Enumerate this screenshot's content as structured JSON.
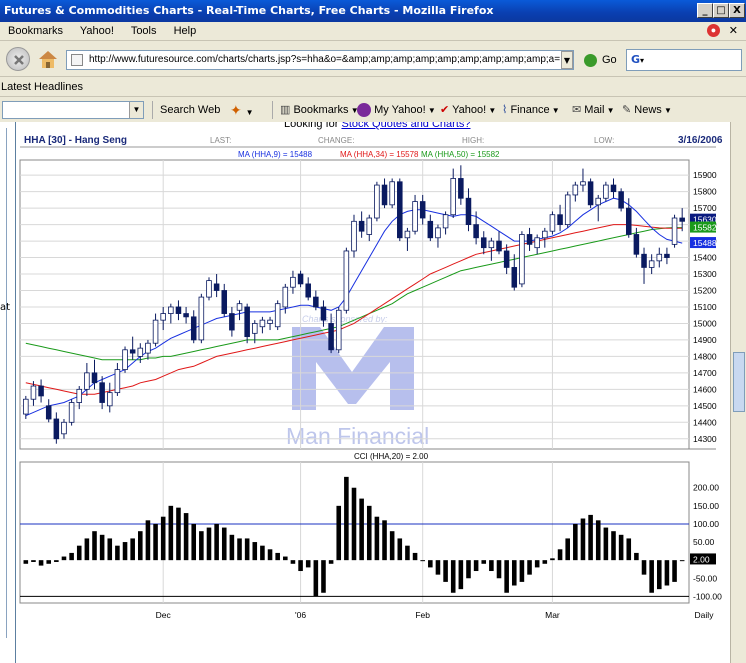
{
  "window": {
    "title": "Futures & Commodities Charts - Real-Time Charts, Free Charts - Mozilla Firefox",
    "minimize": "_",
    "maximize": "□",
    "close": "X"
  },
  "menu": {
    "items": [
      "Bookmarks",
      "Yahoo!",
      "Tools",
      "Help"
    ]
  },
  "nav": {
    "url": "http://www.futuresource.com/charts/charts.jsp?s=hha&o=&amp;amp;amp;amp;amp;amp;amp;amp;amp;a=",
    "go_label": "Go",
    "search_value": "G"
  },
  "headlines": {
    "label": "Latest Headlines"
  },
  "toolbar": {
    "search_web": "Search Web",
    "bookmarks": "Bookmarks",
    "my_yahoo": "My Yahoo!",
    "yahoo": "Yahoo!",
    "finance": "Finance",
    "mail": "Mail",
    "news": "News"
  },
  "page": {
    "looking_prefix": "Looking for ",
    "looking_link": "Stock Quotes and Charts?",
    "left_fragment": "at"
  },
  "chart_header": {
    "symbol": "HHA [30] - Hang Seng",
    "last_label": "LAST:",
    "change_label": "CHANGE:",
    "high_label": "HIGH:",
    "low_label": "LOW:",
    "date": "3/16/2006",
    "ma9": "MA (HHA,9) = 15488",
    "ma34": "MA (HHA,34) = 15578",
    "ma50": "MA (HHA,50) = 15582",
    "cci_title": "CCI (HHA,20) = 2.00",
    "watermark_sponsor": "Charts sponsored by:",
    "watermark_name": "Man Financial"
  },
  "chart_data": [
    {
      "type": "candlestick",
      "title": "HHA [30] - Hang Seng",
      "ylim": [
        14250,
        15980
      ],
      "y_ticks": [
        14300,
        14400,
        14500,
        14600,
        14700,
        14800,
        14900,
        15000,
        15100,
        15200,
        15300,
        15400,
        15500,
        15600,
        15700,
        15800,
        15900
      ],
      "x_ticks": [
        "Dec",
        "'06",
        "Feb",
        "Mar",
        "Daily"
      ],
      "price_tags": [
        {
          "label": "15630",
          "color": "#0a1a80"
        },
        {
          "label": "15582",
          "color": "#1a9a1a"
        },
        {
          "label": "15488",
          "color": "#1830e0"
        }
      ],
      "ohlc": [
        [
          14450,
          14560,
          14420,
          14540
        ],
        [
          14540,
          14650,
          14500,
          14620
        ],
        [
          14620,
          14660,
          14520,
          14560
        ],
        [
          14500,
          14540,
          14400,
          14420
        ],
        [
          14420,
          14460,
          14270,
          14300
        ],
        [
          14330,
          14420,
          14300,
          14400
        ],
        [
          14400,
          14540,
          14380,
          14520
        ],
        [
          14520,
          14620,
          14480,
          14600
        ],
        [
          14600,
          14760,
          14560,
          14700
        ],
        [
          14700,
          14780,
          14600,
          14640
        ],
        [
          14640,
          14680,
          14480,
          14520
        ],
        [
          14500,
          14640,
          14460,
          14580
        ],
        [
          14580,
          14760,
          14560,
          14720
        ],
        [
          14720,
          14860,
          14700,
          14840
        ],
        [
          14840,
          14920,
          14780,
          14820
        ],
        [
          14800,
          14880,
          14760,
          14850
        ],
        [
          14820,
          14900,
          14780,
          14880
        ],
        [
          14880,
          15060,
          14860,
          15020
        ],
        [
          15020,
          15100,
          14960,
          15060
        ],
        [
          15060,
          15120,
          15000,
          15100
        ],
        [
          15100,
          15140,
          15020,
          15060
        ],
        [
          15060,
          15100,
          15000,
          15040
        ],
        [
          15040,
          15080,
          14880,
          14900
        ],
        [
          14900,
          15180,
          14880,
          15160
        ],
        [
          15160,
          15280,
          15140,
          15260
        ],
        [
          15240,
          15300,
          15160,
          15200
        ],
        [
          15200,
          15240,
          15040,
          15060
        ],
        [
          15060,
          15100,
          14920,
          14960
        ],
        [
          15080,
          15140,
          15020,
          15120
        ],
        [
          15100,
          15120,
          14880,
          14920
        ],
        [
          14940,
          15020,
          14880,
          15000
        ],
        [
          14980,
          15040,
          14940,
          15020
        ],
        [
          15000,
          15040,
          14960,
          15020
        ],
        [
          14980,
          15140,
          14960,
          15120
        ],
        [
          15100,
          15240,
          15060,
          15220
        ],
        [
          15220,
          15320,
          15180,
          15280
        ],
        [
          15300,
          15320,
          15220,
          15240
        ],
        [
          15240,
          15280,
          15140,
          15160
        ],
        [
          15160,
          15200,
          15080,
          15100
        ],
        [
          15100,
          15140,
          14980,
          15020
        ],
        [
          15000,
          15060,
          14820,
          14840
        ],
        [
          14840,
          15100,
          14820,
          15080
        ],
        [
          15080,
          15460,
          15060,
          15440
        ],
        [
          15440,
          15660,
          15400,
          15620
        ],
        [
          15620,
          15680,
          15520,
          15560
        ],
        [
          15540,
          15660,
          15500,
          15640
        ],
        [
          15640,
          15860,
          15620,
          15840
        ],
        [
          15840,
          15880,
          15700,
          15720
        ],
        [
          15720,
          15880,
          15700,
          15860
        ],
        [
          15860,
          15880,
          15500,
          15520
        ],
        [
          15520,
          15580,
          15440,
          15560
        ],
        [
          15560,
          15780,
          15540,
          15740
        ],
        [
          15740,
          15780,
          15600,
          15640
        ],
        [
          15620,
          15660,
          15500,
          15520
        ],
        [
          15520,
          15600,
          15460,
          15580
        ],
        [
          15580,
          15680,
          15540,
          15660
        ],
        [
          15660,
          15940,
          15640,
          15880
        ],
        [
          15880,
          15960,
          15720,
          15760
        ],
        [
          15760,
          15820,
          15560,
          15600
        ],
        [
          15600,
          15680,
          15480,
          15520
        ],
        [
          15520,
          15560,
          15420,
          15460
        ],
        [
          15460,
          15520,
          15380,
          15500
        ],
        [
          15500,
          15560,
          15420,
          15440
        ],
        [
          15440,
          15480,
          15300,
          15340
        ],
        [
          15340,
          15420,
          15200,
          15220
        ],
        [
          15240,
          15560,
          15220,
          15540
        ],
        [
          15540,
          15580,
          15440,
          15480
        ],
        [
          15460,
          15540,
          15420,
          15520
        ],
        [
          15520,
          15580,
          15460,
          15560
        ],
        [
          15560,
          15680,
          15540,
          15660
        ],
        [
          15660,
          15720,
          15560,
          15600
        ],
        [
          15600,
          15800,
          15580,
          15780
        ],
        [
          15780,
          15860,
          15740,
          15840
        ],
        [
          15840,
          15940,
          15800,
          15860
        ],
        [
          15860,
          15880,
          15700,
          15720
        ],
        [
          15720,
          15780,
          15620,
          15760
        ],
        [
          15760,
          15860,
          15740,
          15840
        ],
        [
          15840,
          15880,
          15760,
          15800
        ],
        [
          15800,
          15820,
          15680,
          15700
        ],
        [
          15700,
          15760,
          15520,
          15540
        ],
        [
          15540,
          15580,
          15400,
          15420
        ],
        [
          15420,
          15460,
          15240,
          15340
        ],
        [
          15340,
          15420,
          15300,
          15380
        ],
        [
          15380,
          15460,
          15340,
          15420
        ],
        [
          15420,
          15460,
          15360,
          15400
        ],
        [
          15480,
          15660,
          15460,
          15640
        ],
        [
          15640,
          15700,
          15560,
          15620
        ]
      ],
      "ma9": [
        14440,
        14460,
        14480,
        14500,
        14510,
        14520,
        14540,
        14560,
        14600,
        14640,
        14660,
        14680,
        14700,
        14720,
        14760,
        14800,
        14830,
        14850,
        14880,
        14910,
        14930,
        14950,
        14970,
        14990,
        15010,
        15030,
        15040,
        15050,
        15060,
        15070,
        15070,
        15070,
        15070,
        15080,
        15090,
        15100,
        15110,
        15110,
        15100,
        15090,
        15080,
        15100,
        15160,
        15240,
        15320,
        15400,
        15480,
        15560,
        15620,
        15660,
        15680,
        15690,
        15690,
        15680,
        15670,
        15660,
        15650,
        15660,
        15660,
        15650,
        15620,
        15590,
        15560,
        15530,
        15500,
        15500,
        15500,
        15510,
        15520,
        15530,
        15550,
        15580,
        15620,
        15660,
        15690,
        15720,
        15740,
        15760,
        15750,
        15720,
        15680,
        15630,
        15580,
        15540,
        15510,
        15500,
        15488
      ],
      "ma34": [
        14640,
        14630,
        14620,
        14610,
        14600,
        14590,
        14580,
        14570,
        14570,
        14570,
        14580,
        14590,
        14600,
        14610,
        14620,
        14640,
        14650,
        14660,
        14680,
        14700,
        14720,
        14730,
        14740,
        14760,
        14780,
        14800,
        14810,
        14820,
        14830,
        14840,
        14850,
        14860,
        14870,
        14880,
        14890,
        14900,
        14910,
        14920,
        14930,
        14940,
        14950,
        14960,
        14980,
        15000,
        15030,
        15060,
        15090,
        15120,
        15150,
        15180,
        15210,
        15240,
        15270,
        15300,
        15320,
        15340,
        15360,
        15380,
        15400,
        15420,
        15430,
        15440,
        15450,
        15460,
        15470,
        15480,
        15490,
        15500,
        15510,
        15520,
        15530,
        15540,
        15550,
        15560,
        15570,
        15580,
        15590,
        15600,
        15600,
        15600,
        15595,
        15590,
        15585,
        15580,
        15578,
        15578,
        15578
      ],
      "ma50": [
        14880,
        14870,
        14860,
        14850,
        14840,
        14830,
        14820,
        14810,
        14800,
        14790,
        14780,
        14780,
        14780,
        14780,
        14780,
        14780,
        14790,
        14790,
        14800,
        14800,
        14810,
        14820,
        14830,
        14840,
        14850,
        14860,
        14870,
        14880,
        14890,
        14900,
        14900,
        14900,
        14900,
        14900,
        14910,
        14920,
        14930,
        14940,
        14950,
        14960,
        14970,
        14980,
        15000,
        15020,
        15040,
        15060,
        15080,
        15100,
        15120,
        15150,
        15180,
        15200,
        15220,
        15240,
        15260,
        15280,
        15300,
        15320,
        15330,
        15340,
        15350,
        15360,
        15370,
        15380,
        15390,
        15400,
        15410,
        15420,
        15430,
        15440,
        15450,
        15460,
        15470,
        15480,
        15490,
        15500,
        15510,
        15520,
        15530,
        15540,
        15550,
        15560,
        15570,
        15575,
        15580,
        15582,
        15582
      ]
    },
    {
      "type": "bar",
      "title": "CCI (HHA,20) = 2.00",
      "ylim": [
        -110,
        260
      ],
      "y_ticks": [
        "200.00",
        "150.00",
        "100.00",
        "50.00",
        "0.00",
        "-50.00",
        "-100.00"
      ],
      "y_tick_values": [
        200,
        150,
        100,
        50,
        0,
        -50,
        -100
      ],
      "reference_lines": [
        100,
        -100
      ],
      "current_label": "2.00",
      "values": [
        -10,
        -5,
        -15,
        -10,
        -5,
        10,
        20,
        40,
        60,
        80,
        70,
        60,
        40,
        50,
        60,
        80,
        110,
        100,
        120,
        150,
        145,
        130,
        100,
        80,
        90,
        100,
        90,
        70,
        60,
        60,
        50,
        40,
        30,
        20,
        10,
        -10,
        -30,
        -20,
        -100,
        -90,
        -10,
        150,
        230,
        200,
        170,
        150,
        120,
        110,
        80,
        60,
        40,
        20,
        0,
        -20,
        -40,
        -60,
        -90,
        -80,
        -50,
        -30,
        -10,
        -30,
        -50,
        -90,
        -70,
        -60,
        -40,
        -20,
        -10,
        5,
        30,
        60,
        100,
        115,
        125,
        110,
        90,
        80,
        70,
        60,
        20,
        -40,
        -90,
        -80,
        -70,
        -60,
        0
      ]
    }
  ]
}
